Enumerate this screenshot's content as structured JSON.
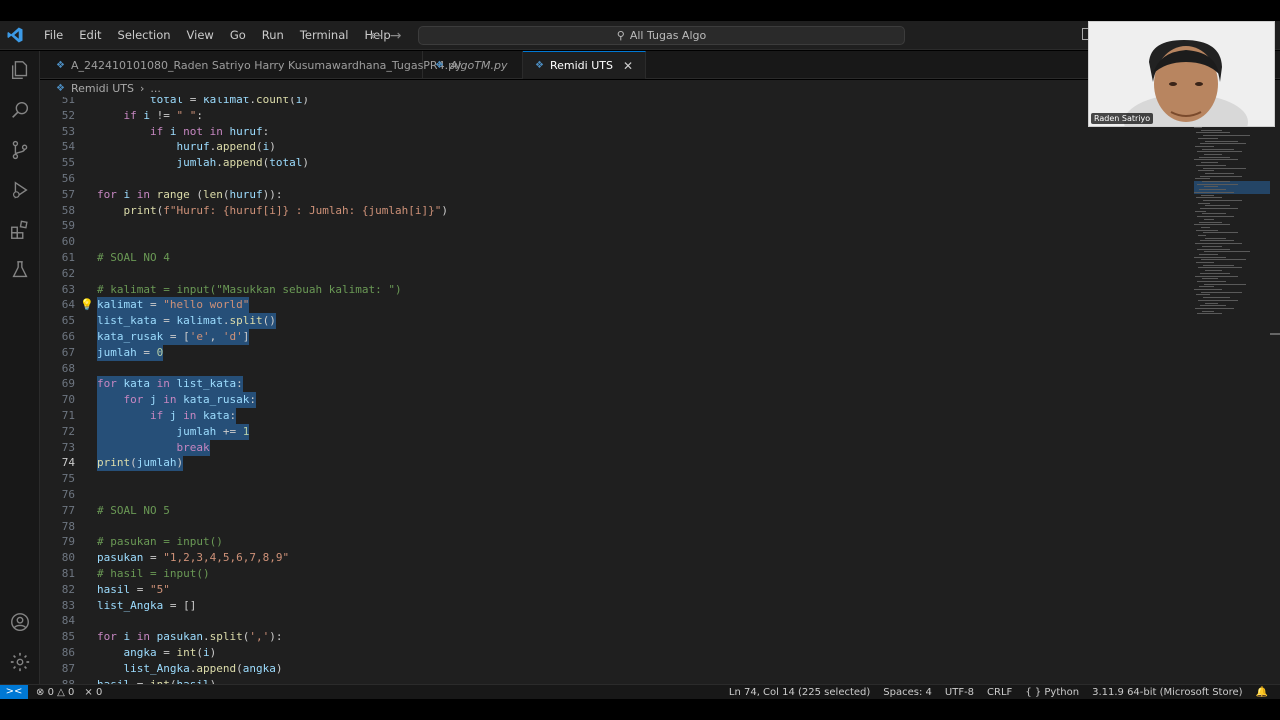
{
  "menu": [
    "File",
    "Edit",
    "Selection",
    "View",
    "Go",
    "Run",
    "Terminal",
    "Help"
  ],
  "search": {
    "label": "All Tugas Algo"
  },
  "tabs": [
    {
      "label": "A_242410101080_Raden Satriyo Harry Kusumawardhana_TugasPR4.py",
      "italic": false,
      "active": false
    },
    {
      "label": "AlgoTM.py",
      "italic": true,
      "active": false
    },
    {
      "label": "Remidi UTS",
      "italic": false,
      "active": true
    }
  ],
  "breadcrumb": {
    "file": "Remidi UTS",
    "symbol": "..."
  },
  "editor": {
    "current_line": 74,
    "lines": [
      {
        "n": "51",
        "t": "        total = kalimat.count(i)"
      },
      {
        "n": "52",
        "t": "    if i != \" \":"
      },
      {
        "n": "53",
        "t": "        if i not in huruf:"
      },
      {
        "n": "54",
        "t": "            huruf.append(i)"
      },
      {
        "n": "55",
        "t": "            jumlah.append(total)"
      },
      {
        "n": "56",
        "t": ""
      },
      {
        "n": "57",
        "t": "for i in range (len(huruf)):"
      },
      {
        "n": "58",
        "t": "    print(f\"Huruf: {huruf[i]} : Jumlah: {jumlah[i]}\")"
      },
      {
        "n": "59",
        "t": ""
      },
      {
        "n": "60",
        "t": ""
      },
      {
        "n": "61",
        "t": "# SOAL NO 4"
      },
      {
        "n": "62",
        "t": ""
      },
      {
        "n": "63",
        "t": "# kalimat = input(\"Masukkan sebuah kalimat: \")"
      },
      {
        "n": "64",
        "t": "kalimat = \"hello world\""
      },
      {
        "n": "65",
        "t": "list_kata = kalimat.split()"
      },
      {
        "n": "66",
        "t": "kata_rusak = ['e', 'd']"
      },
      {
        "n": "67",
        "t": "jumlah = 0"
      },
      {
        "n": "68",
        "t": ""
      },
      {
        "n": "69",
        "t": "for kata in list_kata:"
      },
      {
        "n": "70",
        "t": "    for j in kata_rusak:"
      },
      {
        "n": "71",
        "t": "        if j in kata:"
      },
      {
        "n": "72",
        "t": "            jumlah += 1"
      },
      {
        "n": "73",
        "t": "            break"
      },
      {
        "n": "74",
        "t": "print(jumlah)"
      },
      {
        "n": "75",
        "t": ""
      },
      {
        "n": "76",
        "t": ""
      },
      {
        "n": "77",
        "t": "# SOAL NO 5"
      },
      {
        "n": "78",
        "t": ""
      },
      {
        "n": "79",
        "t": "# pasukan = input()"
      },
      {
        "n": "80",
        "t": "pasukan = \"1,2,3,4,5,6,7,8,9\""
      },
      {
        "n": "81",
        "t": "# hasil = input()"
      },
      {
        "n": "82",
        "t": "hasil = \"5\""
      },
      {
        "n": "83",
        "t": "list_Angka = []"
      },
      {
        "n": "84",
        "t": ""
      },
      {
        "n": "85",
        "t": "for i in pasukan.split(','):"
      },
      {
        "n": "86",
        "t": "    angka = int(i)"
      },
      {
        "n": "87",
        "t": "    list_Angka.append(angka)"
      },
      {
        "n": "88",
        "t": "hasil = int(hasil)"
      }
    ],
    "selected_range": [
      64,
      74
    ]
  },
  "status": {
    "remote": "><",
    "errors": "0",
    "warnings": "0",
    "ports": "0",
    "position": "Ln 74, Col 14 (225 selected)",
    "spaces": "Spaces: 4",
    "encoding": "UTF-8",
    "eol": "CRLF",
    "language": "Python",
    "interpreter": "3.11.9 64-bit (Microsoft Store)"
  },
  "webcam": {
    "name": "Raden Satriyo"
  },
  "colors": {
    "accent": "#0078d4",
    "selection": "#264f78",
    "editor_bg": "#1f1f1f"
  }
}
